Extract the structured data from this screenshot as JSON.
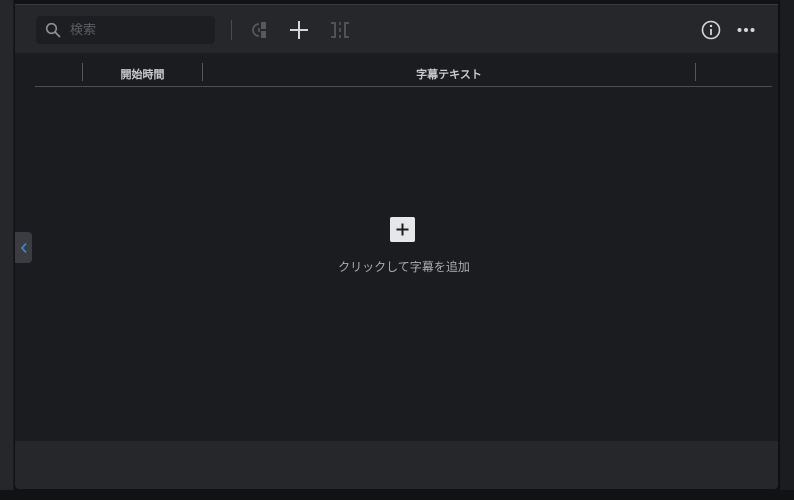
{
  "toolbar": {
    "search_placeholder": "検索",
    "icons": [
      "search-icon",
      "split-subtitle-icon",
      "plus-icon",
      "merge-subtitle-icon",
      "info-icon",
      "more-icon"
    ]
  },
  "table": {
    "columns": [
      "",
      "開始時間",
      "字幕テキスト",
      ""
    ]
  },
  "empty_state": {
    "add_icon": "plus-icon",
    "message": "クリックして字幕を追加"
  },
  "sidebar": {
    "collapse_icon": "chevron-left-icon"
  },
  "colors": {
    "panel_bg": "#1b1c1f",
    "toolbar_bg": "#26272b",
    "accent_blue": "#3d8bd8"
  }
}
